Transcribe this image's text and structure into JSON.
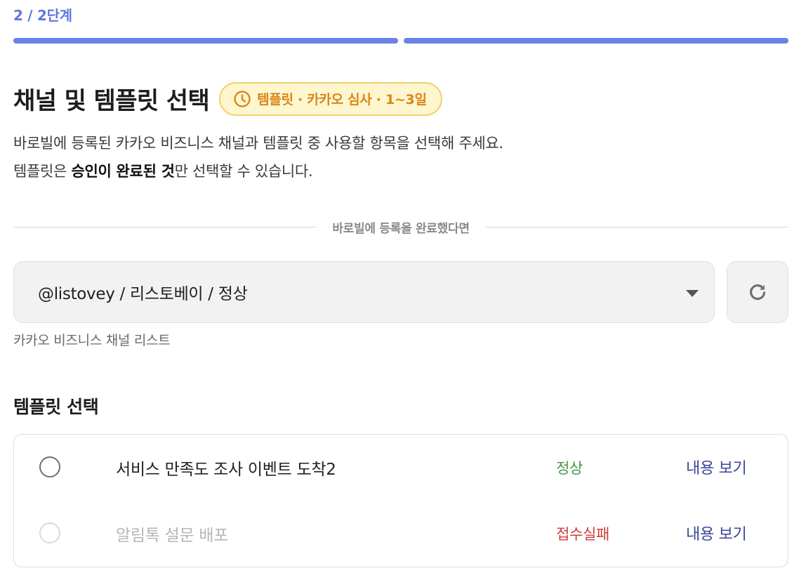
{
  "step": {
    "label": "2 / 2단계",
    "current": 2,
    "total": 2,
    "progress_color": "#6c82e6"
  },
  "header": {
    "title": "채널 및 템플릿 선택",
    "badge": {
      "icon": "clock-icon",
      "text": "템플릿 · 카카오 심사 · 1~3일"
    }
  },
  "description": {
    "line1": "바로빌에 등록된 카카오 비즈니스 채널과 템플릿 중 사용할 항목을 선택해 주세요.",
    "line2_prefix": "템플릿은 ",
    "line2_bold": "승인이 완료된 것",
    "line2_suffix": "만 선택할 수 있습니다."
  },
  "divider": {
    "text": "바로빌에 등록을 완료했다면"
  },
  "channel_select": {
    "value": "@listovey / 리스토베이 / 정상",
    "caption": "카카오 비즈니스 채널 리스트",
    "refresh_icon": "refresh-icon",
    "caret_icon": "caret-down-icon"
  },
  "templates": {
    "section_title": "템플릿 선택",
    "rows": [
      {
        "name": "서비스 만족도 조사 이벤트 도착2",
        "status": "정상",
        "status_color": "#3f9a3f",
        "view_label": "내용 보기",
        "disabled": false
      },
      {
        "name": "알림톡 설문 배포",
        "status": "접수실패",
        "status_color": "#d23a3a",
        "view_label": "내용 보기",
        "disabled": true
      }
    ]
  }
}
